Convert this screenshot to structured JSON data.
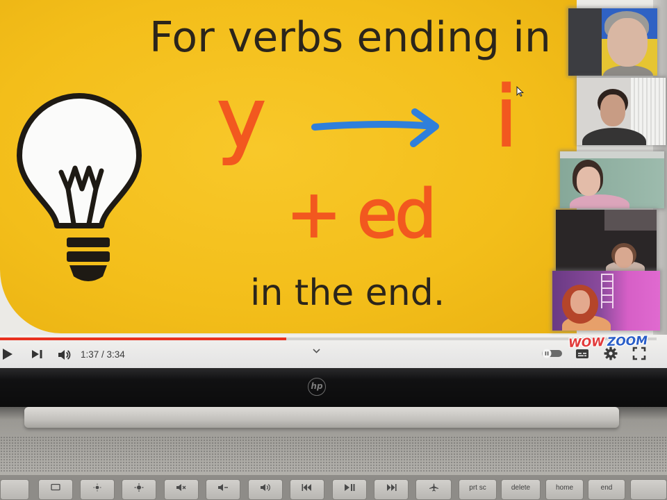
{
  "video": {
    "line1": "For verbs ending in",
    "letter_from": "y",
    "letter_to": "i",
    "suffix": "+ ed",
    "line4": "in the end.",
    "colors": {
      "background": "#f3be1a",
      "orange": "#f2581f",
      "blue": "#2f7fdb",
      "ink": "#2b251b"
    },
    "icons": {
      "bulb": "lightbulb-icon",
      "arrow": "right-arrow-icon",
      "cursor": "cursor-icon"
    }
  },
  "player": {
    "progress_fraction": 0.436,
    "time": "1:37 / 3:34",
    "colors": {
      "played": "#e8311f",
      "unplayed": "#d3d2d0"
    },
    "icons": [
      "play-icon",
      "next-icon",
      "volume-icon",
      "chevron-down-icon",
      "autoplay-toggle",
      "subtitles-icon",
      "settings-icon",
      "fullscreen-icon"
    ]
  },
  "logo": {
    "word1": "WOW",
    "word2": "ZOOM"
  },
  "laptop": {
    "logo": "hp"
  },
  "keyboard": {
    "keys": [
      {},
      {
        "icon": "screen-icon"
      },
      {
        "icon": "brightness-down-icon"
      },
      {
        "icon": "brightness-up-icon"
      },
      {
        "icon": "volume-mute-icon"
      },
      {
        "icon": "volume-down-icon"
      },
      {
        "icon": "volume-up-icon"
      },
      {
        "icon": "previous-track-icon"
      },
      {
        "icon": "play-pause-icon"
      },
      {
        "icon": "next-track-icon"
      },
      {
        "icon": "airplane-mode-icon"
      },
      {
        "label": "prt sc"
      },
      {
        "label": "delete"
      },
      {
        "label": "home"
      },
      {
        "label": "end"
      },
      {}
    ]
  }
}
